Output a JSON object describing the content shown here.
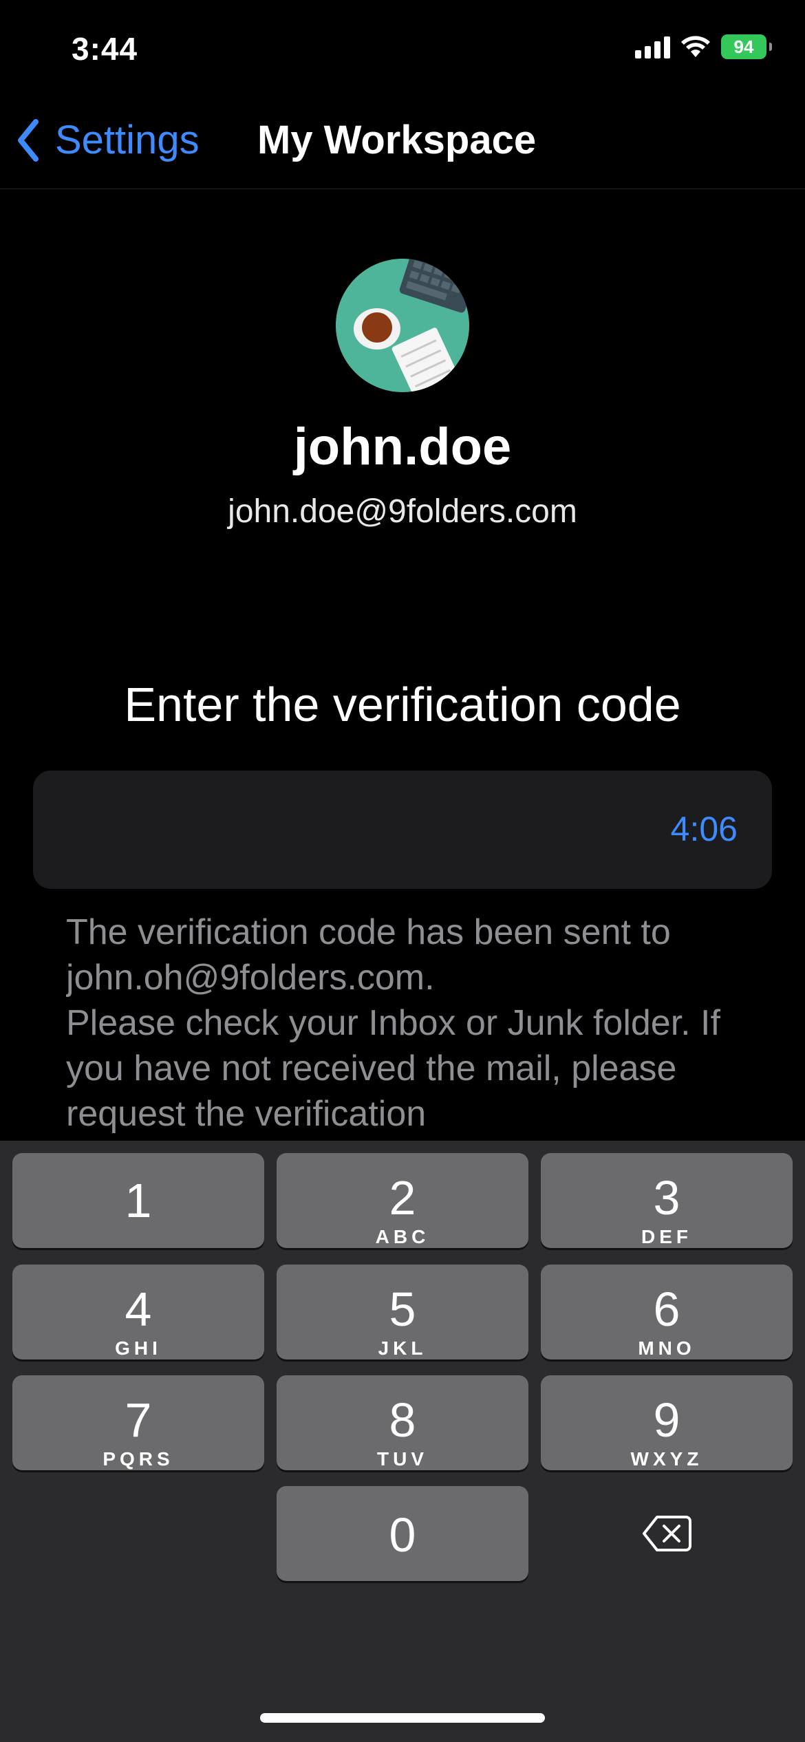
{
  "status_bar": {
    "time": "3:44",
    "battery": "94"
  },
  "nav": {
    "back_label": "Settings",
    "title": "My Workspace"
  },
  "profile": {
    "name": "john.doe",
    "email": "john.doe@9folders.com"
  },
  "verification": {
    "heading": "Enter the verification code",
    "timer": "4:06",
    "info_line1": "The verification code has been sent to john.oh@9folders.com.",
    "info_line2": "Please check your Inbox or Junk folder. If you have not received the mail, please request the verification"
  },
  "keypad": {
    "keys": [
      {
        "num": "1",
        "letters": ""
      },
      {
        "num": "2",
        "letters": "ABC"
      },
      {
        "num": "3",
        "letters": "DEF"
      },
      {
        "num": "4",
        "letters": "GHI"
      },
      {
        "num": "5",
        "letters": "JKL"
      },
      {
        "num": "6",
        "letters": "MNO"
      },
      {
        "num": "7",
        "letters": "PQRS"
      },
      {
        "num": "8",
        "letters": "TUV"
      },
      {
        "num": "9",
        "letters": "WXYZ"
      },
      {
        "num": "0",
        "letters": ""
      }
    ],
    "delete_icon": "backspace-icon"
  },
  "colors": {
    "accent": "#3d8bfd",
    "battery": "#34c759",
    "avatar_bg": "#4fb59a"
  }
}
